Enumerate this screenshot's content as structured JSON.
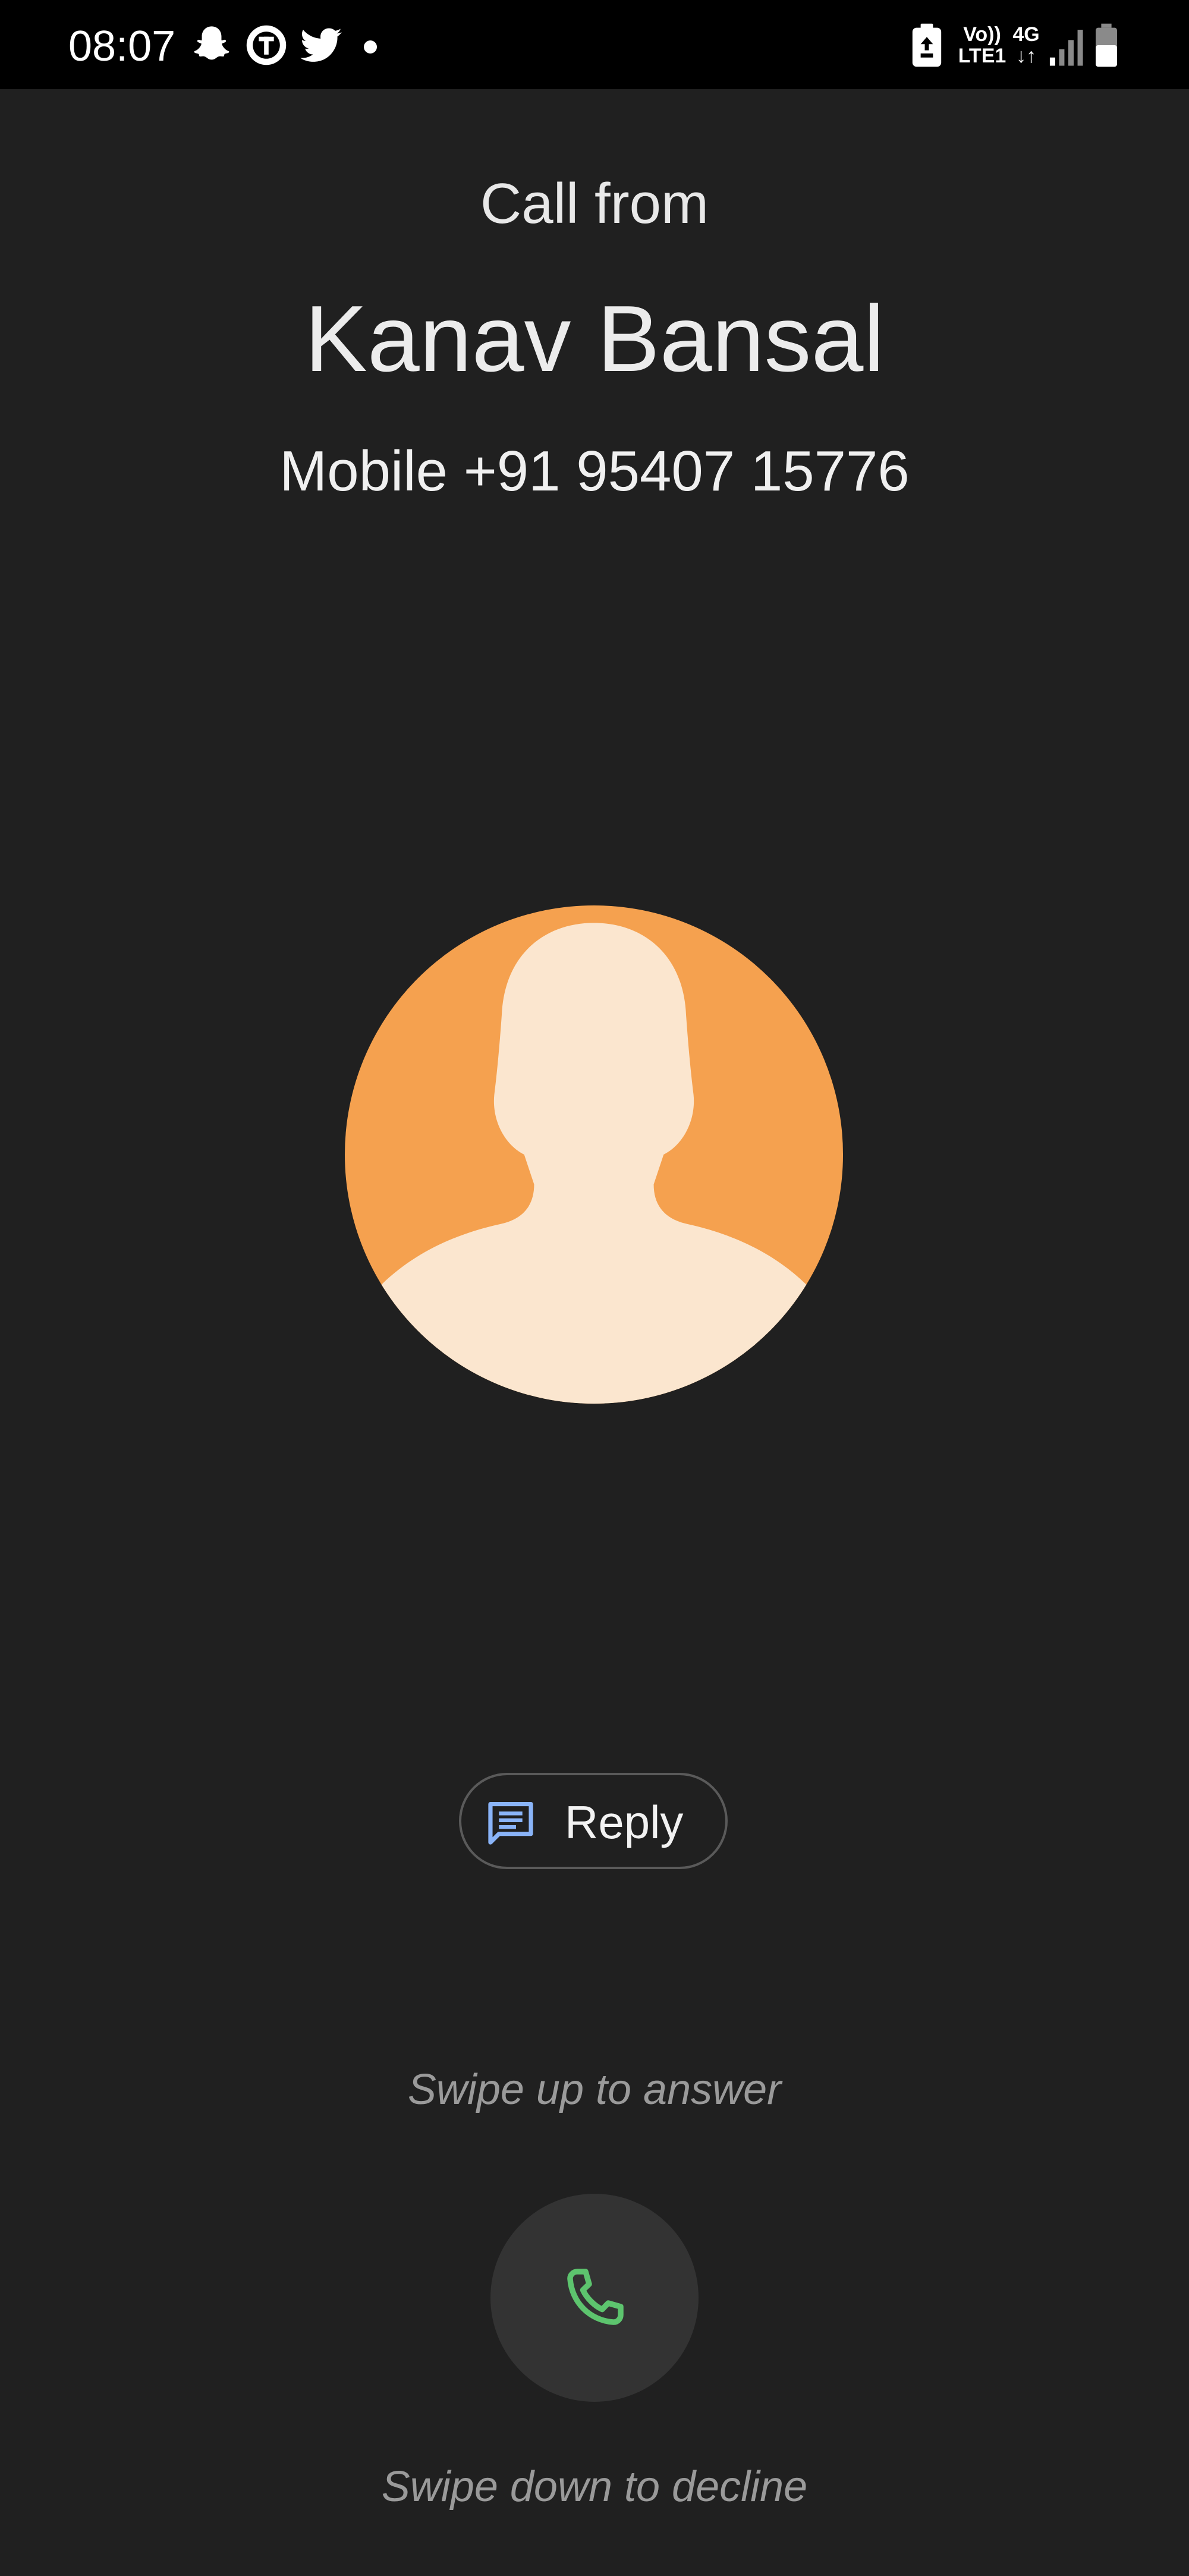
{
  "status_bar": {
    "time": "08:07",
    "left_icons": [
      "snapchat-icon",
      "teachmint-icon",
      "twitter-icon",
      "notification-dot"
    ],
    "right_icons": [
      "battery-saver-icon",
      "volte-lte-icon",
      "network-4g-icon",
      "signal-icon",
      "battery-icon"
    ],
    "volte_line1": "Vo))",
    "volte_line2": "LTE1",
    "network_type": "4G",
    "network_arrows": "↓↑"
  },
  "call": {
    "label": "Call from",
    "caller_name": "Kanav Bansal",
    "caller_number": "Mobile +91 95407 15776"
  },
  "avatar": {
    "background_color": "#F5A14F",
    "silhouette_color": "#FBE6CF"
  },
  "reply": {
    "label": "Reply",
    "icon": "message-icon",
    "icon_color": "#8AB4F8"
  },
  "hints": {
    "swipe_up": "Swipe up to answer",
    "swipe_down": "Swipe down to decline"
  },
  "answer": {
    "icon": "phone-icon",
    "icon_color": "#5DC46E"
  },
  "colors": {
    "background": "#202020",
    "status_bar": "#000000",
    "handle": "#333333"
  }
}
